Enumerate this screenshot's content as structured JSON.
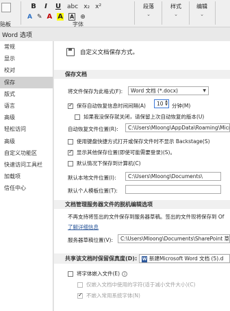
{
  "ribbon": {
    "clipboard_label": "贴板",
    "format_buttons": [
      "B",
      "I",
      "U"
    ],
    "font_group_label": "字体",
    "paragraph_label": "段落",
    "styles_label": "样式",
    "editing_label": "编辑"
  },
  "dialog": {
    "title": "Word 选项"
  },
  "nav": {
    "items": [
      {
        "label": "常规"
      },
      {
        "label": "显示"
      },
      {
        "label": "校对"
      },
      {
        "label": "保存",
        "active": true
      },
      {
        "label": "版式"
      },
      {
        "label": "语言"
      },
      {
        "label": "高级"
      },
      {
        "label": "轻松访问"
      },
      {
        "label": "高级"
      },
      {
        "label": "自定义功能区"
      },
      {
        "label": "快速访问工具栏"
      },
      {
        "label": "加载项"
      },
      {
        "label": "信任中心"
      }
    ]
  },
  "content": {
    "header": "自定义文档保存方式。",
    "save_docs": {
      "section_label": "保存文档",
      "format_label": "将文件保存为此格式(F):",
      "format_value": "Word 文档 (*.docx)",
      "autorecover_label": "保存自动恢复信息时间间隔(A)",
      "autorecover_value": "10",
      "autorecover_unit": "分钟(M)",
      "keep_last_label": "如果我没保存就关闭，请保留上次自动恢复的版本(U)",
      "autorecover_location_label": "自动恢复文件位置(R):",
      "autorecover_location_value": "C:\\Users\\Mloong\\AppData\\Roaming\\Micr",
      "no_backstage_label": "使用键盘快捷方式打开或保存文件时不显示 Backstage(S)",
      "show_more_places_label": "显示其他保存位置(即使可能需要登录)(S)。",
      "default_to_computer_label": "默认情况下保存到计算机(C)",
      "local_location_label": "默认本地文件位置(I):",
      "local_location_value": "C:\\Users\\Mloong\\Documents\\",
      "personal_templates_label": "默认个人模板位置(T):",
      "personal_templates_value": ""
    },
    "offline": {
      "section_label": "文档管理服务器文件的脱机编辑选项",
      "description": "不再支持将签出的文件保存到服务器草稿。签出的文件现将保存到 Of",
      "more_info_link": "了解详细信息",
      "drafts_label": "服务器草稿位置(V):",
      "drafts_value": "C:\\Users\\Mloong\\Documents\\SharePoint 草"
    },
    "fidelity": {
      "section_label": "共享该文档时保留保真度(D):",
      "doc_value": "新建Microsoft Word 文档 (5).d",
      "embed_fonts_label": "将字体嵌入文件(E)",
      "embed_only_used_label": "仅嵌入文档中使用的字符(适于减小文件大小)(C)",
      "no_common_fonts_label": "不嵌入常用系统字体(N)"
    }
  },
  "colors": {
    "active_nav": "#d2d2d2",
    "section_bg": "#f0f0f0",
    "link": "#2b579a"
  }
}
